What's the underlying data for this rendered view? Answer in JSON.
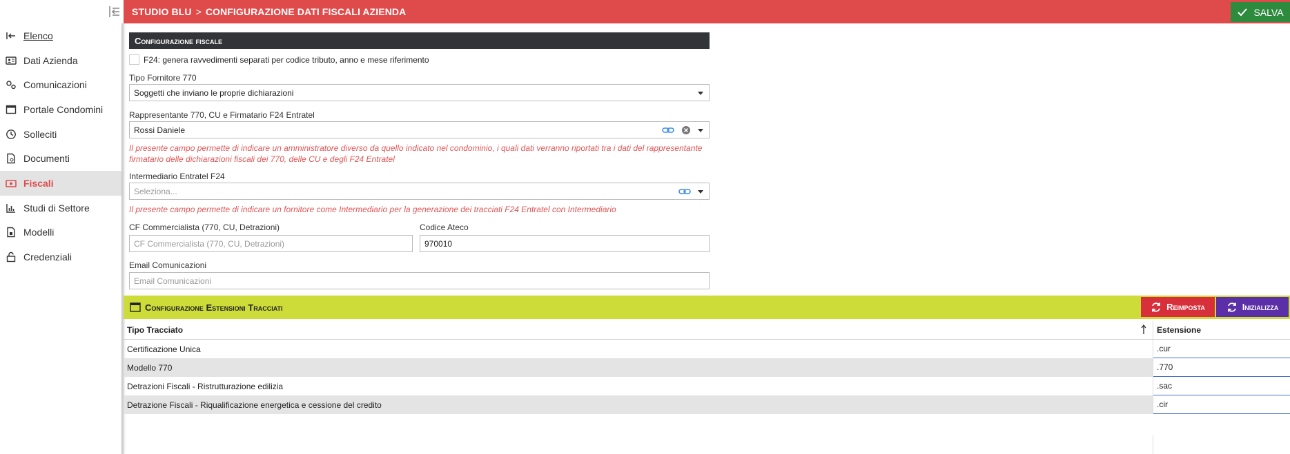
{
  "header": {
    "breadcrumb_root": "STUDIO BLU",
    "breadcrumb_sep": ">",
    "breadcrumb_page": "CONFIGURAZIONE DATI FISCALI AZIENDA",
    "save_label": "SALVA",
    "colors": {
      "bar": "#df4b4b",
      "save": "#2e8b3e"
    }
  },
  "sidebar": {
    "items": [
      {
        "label": "Elenco",
        "icon": "back-list-icon"
      },
      {
        "label": "Dati Azienda",
        "icon": "id-card-icon"
      },
      {
        "label": "Comunicazioni",
        "icon": "gears-icon"
      },
      {
        "label": "Portale Condomini",
        "icon": "window-icon"
      },
      {
        "label": "Solleciti",
        "icon": "clock-icon"
      },
      {
        "label": "Documenti",
        "icon": "document-icon"
      },
      {
        "label": "Fiscali",
        "icon": "money-icon",
        "active": true
      },
      {
        "label": "Studi di Settore",
        "icon": "bar-chart-icon"
      },
      {
        "label": "Modelli",
        "icon": "file-model-icon"
      },
      {
        "label": "Credenziali",
        "icon": "lock-icon"
      }
    ]
  },
  "fiscal": {
    "section_title": "Configurazione fiscale",
    "f24_checkbox_label": "F24: genera ravvedimenti separati per codice tributo, anno e mese riferimento",
    "f24_checked": false,
    "tipo_fornitore_label": "Tipo Fornitore 770",
    "tipo_fornitore_value": "Soggetti che inviano le proprie dichiarazioni",
    "rappresentante_label": "Rappresentante 770, CU e Firmatario F24 Entratel",
    "rappresentante_value": "Rossi Daniele",
    "rappresentante_hint": "Il presente campo permette di indicare un amministratore diverso da quello indicato nel condominio, i quali dati verranno riportati tra i dati del rappresentante firmatario delle dichiarazioni fiscali dei 770, delle CU e degli F24 Entratel",
    "intermediario_label": "Intermediario Entratel F24",
    "intermediario_placeholder": "Seleziona...",
    "intermediario_hint": "Il presente campo permette di indicare un fornitore come Intermediario per la generazione dei tracciati F24 Entratel con Intermediario",
    "cf_label": "CF Commercialista (770, CU, Detrazioni)",
    "cf_placeholder": "CF Commercialista (770, CU, Detrazioni)",
    "ateco_label": "Codice Ateco",
    "ateco_value": "970010",
    "email_label": "Email Comunicazioni",
    "email_placeholder": "Email Comunicazioni"
  },
  "extensions": {
    "title": "Configurazione Estensioni Tracciati",
    "reimposta_label": "Reimposta",
    "inizializza_label": "Inizializza",
    "col_tipo": "Tipo Tracciato",
    "col_estensione": "Estensione",
    "rows": [
      {
        "tipo": "Certificazione Unica",
        "estensione": ".cur"
      },
      {
        "tipo": "Modello 770",
        "estensione": ".770"
      },
      {
        "tipo": "Detrazioni Fiscali - Ristrutturazione edilizia",
        "estensione": ".sac"
      },
      {
        "tipo": "Detrazione Fiscali - Riqualificazione energetica e cessione del credito",
        "estensione": ".cir"
      }
    ],
    "colors": {
      "header": "#cddc39",
      "reimposta": "#d7303a",
      "inizializza": "#5b2fa7"
    }
  }
}
